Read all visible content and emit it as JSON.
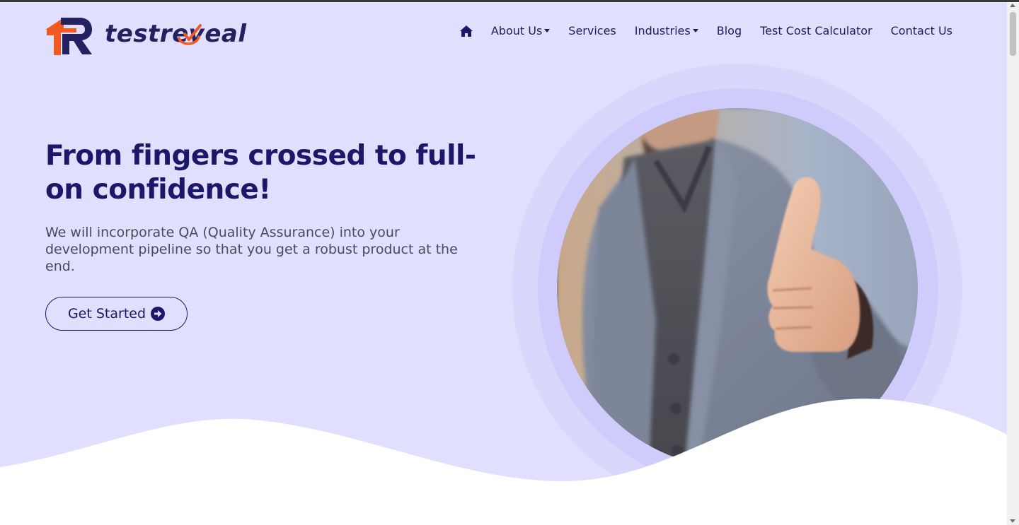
{
  "brand": {
    "logo_text_prefix": "testre",
    "logo_text_suffix": "eal",
    "logo_text_full": "testreveal",
    "colors": {
      "navy": "#232160",
      "orange": "#f05a22",
      "hero_bg": "#e0dffd"
    }
  },
  "nav": {
    "home_icon": "home-icon",
    "items": [
      {
        "label": "About Us",
        "dropdown": true
      },
      {
        "label": "Services",
        "dropdown": false
      },
      {
        "label": "Industries",
        "dropdown": true
      },
      {
        "label": "Blog",
        "dropdown": false
      },
      {
        "label": "Test Cost Calculator",
        "dropdown": false
      },
      {
        "label": "Contact Us",
        "dropdown": false
      }
    ]
  },
  "hero": {
    "title": "From fingers crossed to full-on confidence!",
    "subtitle": "We will incorporate QA (Quality Assurance) into your development pipeline so that you get a robust product at the end.",
    "cta_label": "Get Started",
    "cta_icon": "arrow-circle-right-icon",
    "image_icon": "thumbs-up-man-photo"
  }
}
